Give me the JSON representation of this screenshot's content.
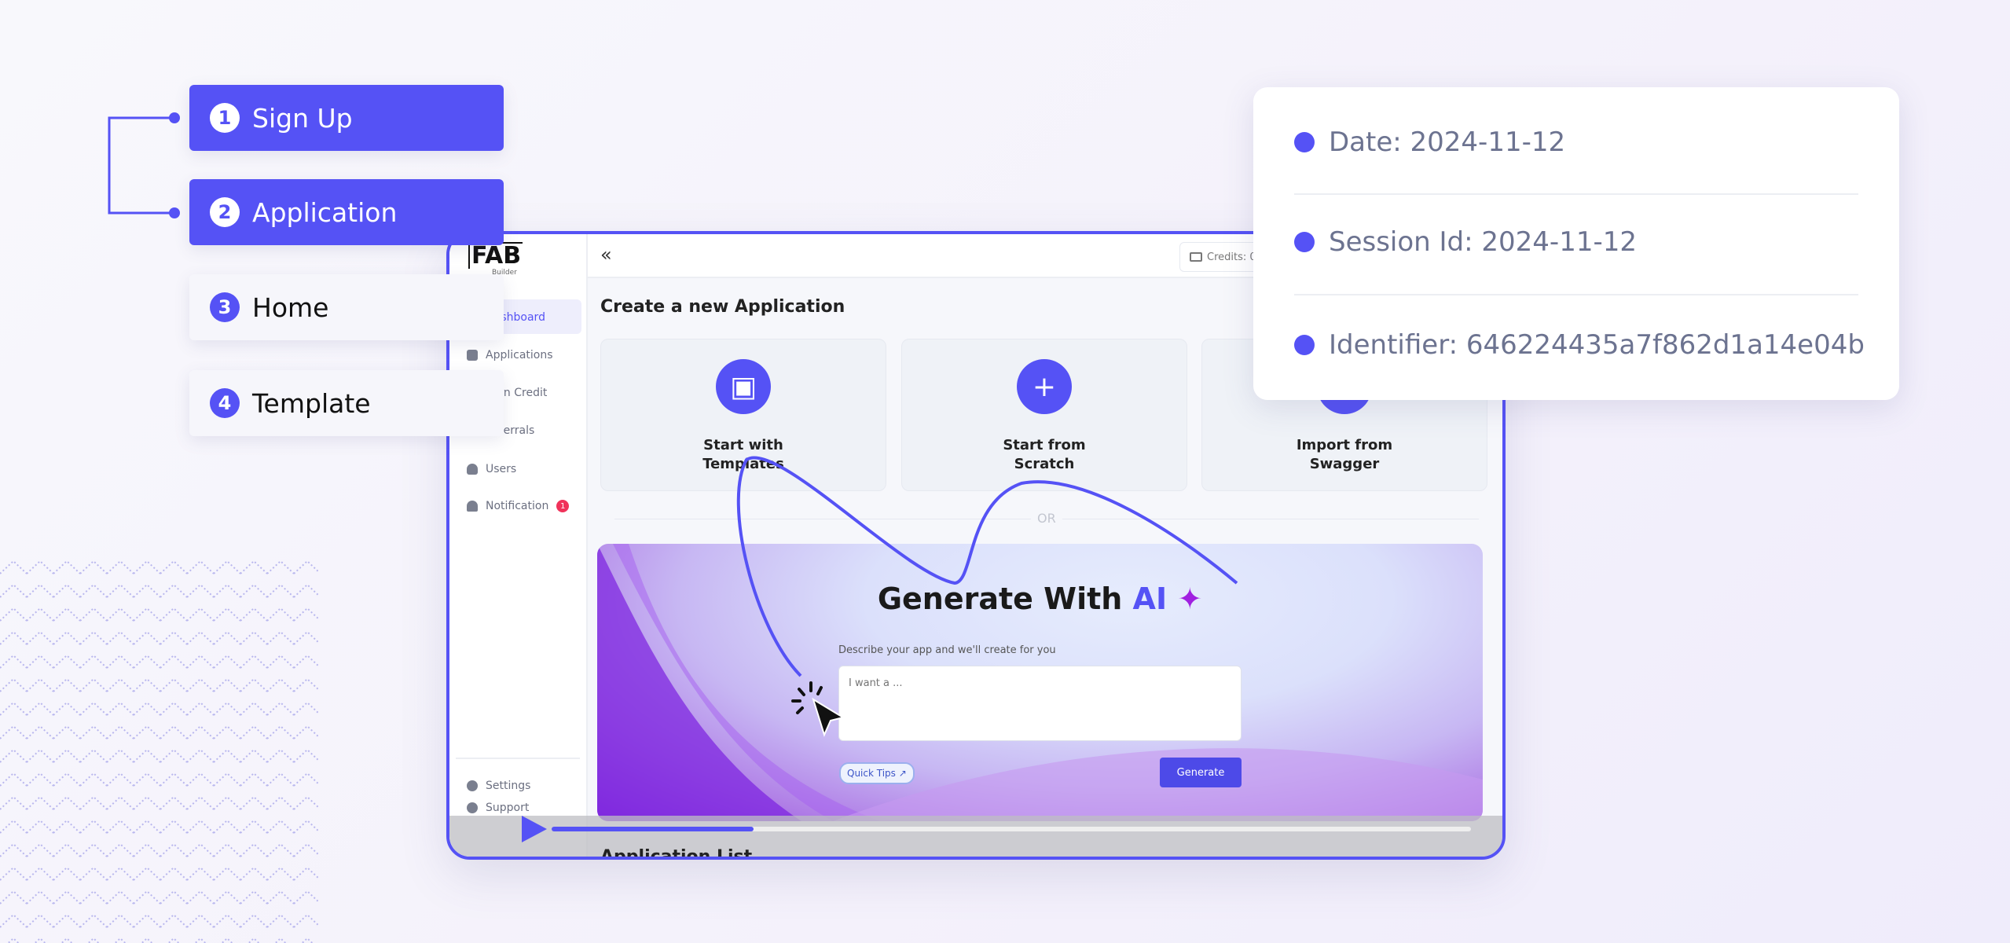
{
  "steps": [
    {
      "num": "1",
      "label": "Sign Up",
      "active": true
    },
    {
      "num": "2",
      "label": "Application",
      "active": true
    },
    {
      "num": "3",
      "label": "Home",
      "active": false
    },
    {
      "num": "4",
      "label": "Template",
      "active": false
    }
  ],
  "app": {
    "logo": "FAB",
    "logo_sub": "Builder",
    "sidebar": {
      "items": [
        "Dashboard",
        "Applications",
        "Earn Credit",
        "Referrals",
        "Users",
        "Notification"
      ],
      "notification_badge": "1",
      "bottom": [
        "Settings",
        "Support"
      ]
    },
    "header": {
      "collapse_icon": "double-chevron-left-icon",
      "credits": "Credits: 0"
    },
    "main": {
      "title": "Create a new Application",
      "cards": [
        {
          "line1": "Start with",
          "line2": "Templates",
          "icon": "template-icon"
        },
        {
          "line1": "Start from",
          "line2": "Scratch",
          "icon": "plus-icon"
        },
        {
          "line1": "Import from",
          "line2": "Swagger",
          "icon": "import-icon"
        }
      ],
      "or": "OR",
      "ai": {
        "title": "Generate With",
        "title_accent": "AI",
        "label": "Describe your app and we'll create for you",
        "placeholder": "I want a ...",
        "quick_tips": "Quick Tips ↗",
        "generate": "Generate"
      },
      "list_title": "Application List"
    }
  },
  "video": {
    "progress_percent": 22
  },
  "info": {
    "items": [
      "Date: 2024-11-12",
      "Session Id: 2024-11-12",
      "Identifier: 646224435a7f862d1a14e04b"
    ]
  },
  "colors": {
    "accent": "#5552f5",
    "badge": "#f0325a"
  }
}
